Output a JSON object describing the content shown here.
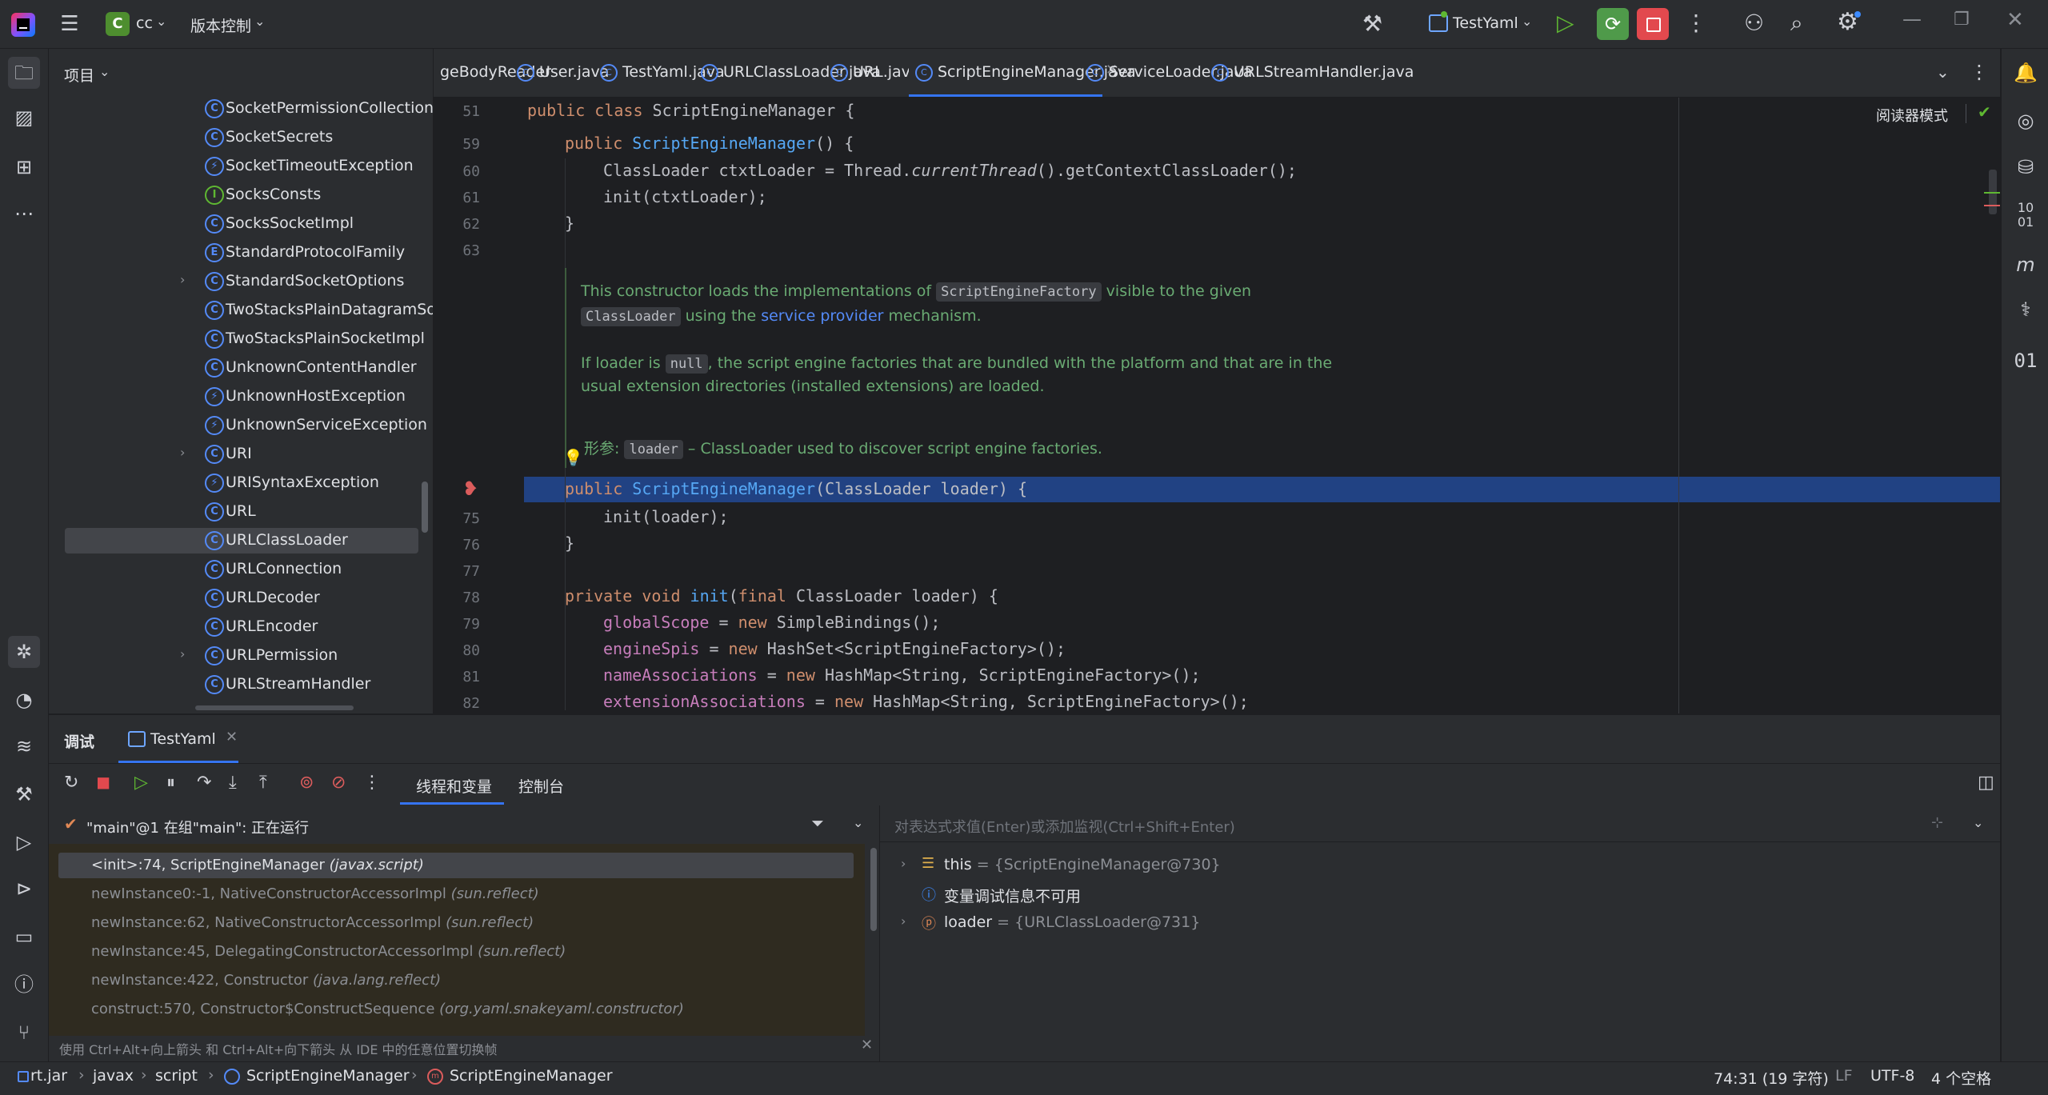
{
  "titlebar": {
    "project_badge": "C",
    "project_name": "cc",
    "vcs_label": "版本控制",
    "run_config": "TestYaml"
  },
  "project_panel": {
    "title": "项目",
    "items": [
      {
        "label": "SocketPermissionCollection",
        "kind": "class",
        "expandable": false
      },
      {
        "label": "SocketSecrets",
        "kind": "class",
        "expandable": false
      },
      {
        "label": "SocketTimeoutException",
        "kind": "exception",
        "expandable": false
      },
      {
        "label": "SocksConsts",
        "kind": "interface",
        "expandable": false
      },
      {
        "label": "SocksSocketImpl",
        "kind": "class",
        "expandable": false
      },
      {
        "label": "StandardProtocolFamily",
        "kind": "enum",
        "expandable": false
      },
      {
        "label": "StandardSocketOptions",
        "kind": "class",
        "expandable": true
      },
      {
        "label": "TwoStacksPlainDatagramSock",
        "kind": "class",
        "expandable": false
      },
      {
        "label": "TwoStacksPlainSocketImpl",
        "kind": "class",
        "expandable": false
      },
      {
        "label": "UnknownContentHandler",
        "kind": "class",
        "expandable": false
      },
      {
        "label": "UnknownHostException",
        "kind": "exception",
        "expandable": false
      },
      {
        "label": "UnknownServiceException",
        "kind": "exception",
        "expandable": false
      },
      {
        "label": "URI",
        "kind": "class",
        "expandable": true
      },
      {
        "label": "URISyntaxException",
        "kind": "exception",
        "expandable": false
      },
      {
        "label": "URL",
        "kind": "class",
        "expandable": false
      },
      {
        "label": "URLClassLoader",
        "kind": "class",
        "expandable": false,
        "selected": true
      },
      {
        "label": "URLConnection",
        "kind": "class",
        "expandable": false
      },
      {
        "label": "URLDecoder",
        "kind": "class",
        "expandable": false
      },
      {
        "label": "URLEncoder",
        "kind": "class",
        "expandable": false
      },
      {
        "label": "URLPermission",
        "kind": "class",
        "expandable": true
      },
      {
        "label": "URLStreamHandler",
        "kind": "class",
        "expandable": false
      }
    ]
  },
  "editor_tabs": [
    {
      "label": "geBodyReader"
    },
    {
      "label": "User.java"
    },
    {
      "label": "TestYaml.java"
    },
    {
      "label": "URLClassLoader.java"
    },
    {
      "label": "URL.java"
    },
    {
      "label": "ScriptEngineManager.java",
      "active": true
    },
    {
      "label": "ServiceLoader.java"
    },
    {
      "label": "URLStreamHandler.java"
    }
  ],
  "editor": {
    "reader_mode": "阅读器模式",
    "line_numbers": {
      "l51": "51",
      "l59": "59",
      "l60": "60",
      "l61": "61",
      "l62": "62",
      "l63": "63",
      "l75": "75",
      "l76": "76",
      "l77": "77",
      "l78": "78",
      "l79": "79",
      "l80": "80",
      "l81": "81",
      "l82": "82"
    },
    "code": {
      "c51_kw": "public class ",
      "c51_rest": "ScriptEngineManager {",
      "c59_kw": "public ",
      "c59_fn": "ScriptEngineManager",
      "c59_rest": "() {",
      "c60_a": "ClassLoader ctxtLoader = Thread.",
      "c60_b": "currentThread",
      "c60_c": "().getContextClassLoader();",
      "c61": "init(ctxtLoader);",
      "c62": "}",
      "c74_kw": "public ",
      "c74_fn": "ScriptEngineManager",
      "c74_rest": "(ClassLoader loader) {",
      "c75": "init(loader);",
      "c76": "}",
      "c78_kw": "private void ",
      "c78_fn": "init",
      "c78_a": "(",
      "c78_kw2": "final ",
      "c78_rest": "ClassLoader loader) {",
      "c79_f": "globalScope",
      "c79_a": " = ",
      "c79_kw": "new ",
      "c79_rest": "SimpleBindings();",
      "c80_f": "engineSpis",
      "c80_a": " = ",
      "c80_kw": "new ",
      "c80_rest": "HashSet<ScriptEngineFactory>();",
      "c81_f": "nameAssociations",
      "c81_a": " = ",
      "c81_kw": "new ",
      "c81_rest": "HashMap<String, ScriptEngineFactory>();",
      "c82_f": "extensionAssociations",
      "c82_a": " = ",
      "c82_kw": "new ",
      "c82_rest": "HashMap<String, ScriptEngineFactory>();"
    },
    "doc": {
      "p1_a": "This constructor loads the implementations of ",
      "p1_chip": "ScriptEngineFactory",
      "p1_b": " visible to the given",
      "p2_chip": "ClassLoader",
      "p2_a": " using the ",
      "p2_link": "service provider",
      "p2_b": " mechanism.",
      "p3_a": "If loader is ",
      "p3_chip": "null",
      "p3_b": ", the script engine factories that are bundled with the platform and that are in the",
      "p4": "usual extension directories (installed extensions) are loaded.",
      "param_label": "形参:",
      "param_chip": "loader",
      "param_desc": " – ClassLoader used to discover script engine factories."
    }
  },
  "debug": {
    "title": "调试",
    "session_tab": "TestYaml",
    "threads_tab": "线程和变量",
    "console_tab": "控制台",
    "thread_status": "\"main\"@1 在组\"main\": 正在运行",
    "frames": [
      {
        "method": "<init>:74, ScriptEngineManager ",
        "pkg": "(javax.script)",
        "selected": true
      },
      {
        "method": "newInstance0:-1, NativeConstructorAccessorImpl ",
        "pkg": "(sun.reflect)"
      },
      {
        "method": "newInstance:62, NativeConstructorAccessorImpl ",
        "pkg": "(sun.reflect)"
      },
      {
        "method": "newInstance:45, DelegatingConstructorAccessorImpl ",
        "pkg": "(sun.reflect)"
      },
      {
        "method": "newInstance:422, Constructor ",
        "pkg": "(java.lang.reflect)"
      },
      {
        "method": "construct:570, Constructor$ConstructSequence ",
        "pkg": "(org.yaml.snakeyaml.constructor)"
      }
    ],
    "frames_hint": "使用 Ctrl+Alt+向上箭头 和 Ctrl+Alt+向下箭头 从 IDE 中的任意位置切换帧",
    "watch_placeholder": "对表达式求值(Enter)或添加监视(Ctrl+Shift+Enter)",
    "vars": {
      "this_name": "this",
      "this_val": " = {ScriptEngineManager@730}",
      "info": "变量调试信息不可用",
      "loader_name": "loader",
      "loader_val": " = {URLClassLoader@731}"
    }
  },
  "statusbar": {
    "crumbs": [
      "rt.jar",
      "javax",
      "script",
      "ScriptEngineManager",
      "ScriptEngineManager"
    ],
    "position": "74:31 (19 字符)",
    "line_sep": "LF",
    "encoding": "UTF-8",
    "indent": "4 个空格"
  }
}
